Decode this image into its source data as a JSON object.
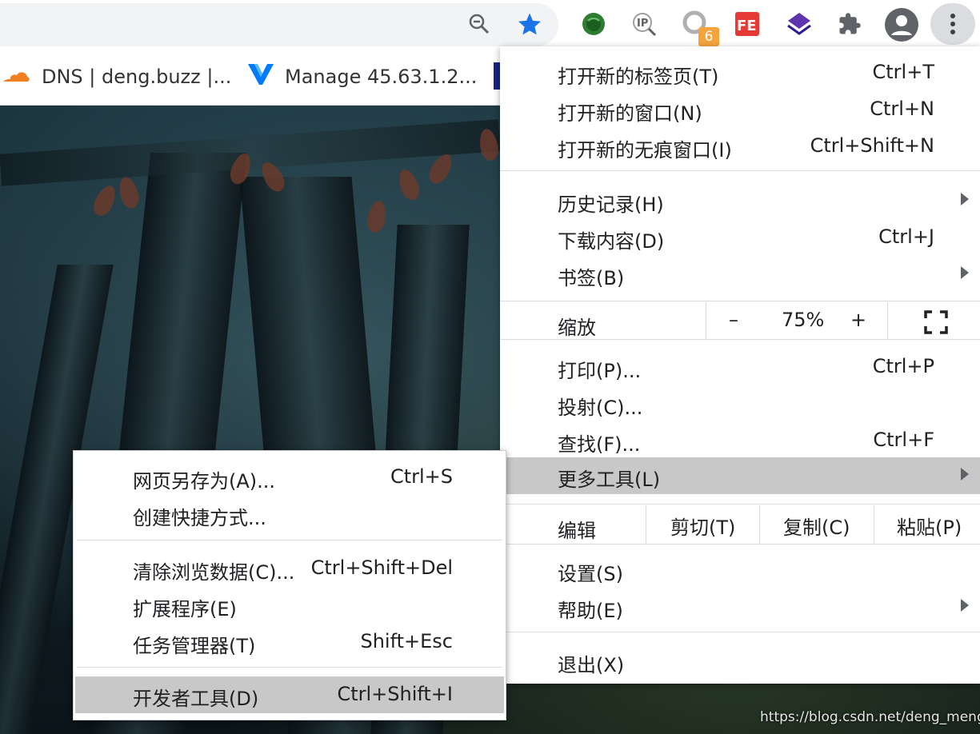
{
  "bookmarks": [
    {
      "label": "DNS | deng.buzz |...",
      "icon": "cloudflare-icon"
    },
    {
      "label": "Manage 45.63.1.2...",
      "icon": "vultr-icon"
    }
  ],
  "toolbar": {
    "extension_badge": "6",
    "extensions": [
      "zoom-icon",
      "bookmark-star-icon",
      "globe-extension-icon",
      "ip-lookup-icon",
      "badge-extension-icon",
      "fe-helper-icon",
      "layers-extension-icon",
      "extensions-puzzle-icon",
      "profile-avatar-icon",
      "kebab-menu-icon"
    ]
  },
  "main_menu": {
    "new_tab": {
      "label": "打开新的标签页(T)",
      "shortcut": "Ctrl+T"
    },
    "new_window": {
      "label": "打开新的窗口(N)",
      "shortcut": "Ctrl+N"
    },
    "new_incognito": {
      "label": "打开新的无痕窗口(I)",
      "shortcut": "Ctrl+Shift+N"
    },
    "history": {
      "label": "历史记录(H)"
    },
    "downloads": {
      "label": "下载内容(D)",
      "shortcut": "Ctrl+J"
    },
    "bookmarks": {
      "label": "书签(B)"
    },
    "zoom": {
      "label": "缩放",
      "minus": "–",
      "value": "75%",
      "plus": "+"
    },
    "print": {
      "label": "打印(P)...",
      "shortcut": "Ctrl+P"
    },
    "cast": {
      "label": "投射(C)..."
    },
    "find": {
      "label": "查找(F)...",
      "shortcut": "Ctrl+F"
    },
    "more_tools": {
      "label": "更多工具(L)"
    },
    "edit": {
      "label": "编辑",
      "cut": "剪切(T)",
      "copy": "复制(C)",
      "paste": "粘贴(P)"
    },
    "settings": {
      "label": "设置(S)"
    },
    "help": {
      "label": "帮助(E)"
    },
    "exit": {
      "label": "退出(X)"
    }
  },
  "sub_menu": {
    "save_page": {
      "label": "网页另存为(A)...",
      "shortcut": "Ctrl+S"
    },
    "create_shortcut": {
      "label": "创建快捷方式..."
    },
    "clear_data": {
      "label": "清除浏览数据(C)...",
      "shortcut": "Ctrl+Shift+Del"
    },
    "extensions": {
      "label": "扩展程序(E)"
    },
    "task_manager": {
      "label": "任务管理器(T)",
      "shortcut": "Shift+Esc"
    },
    "dev_tools": {
      "label": "开发者工具(D)",
      "shortcut": "Ctrl+Shift+I"
    }
  },
  "watermark": "https://blog.csdn.net/deng_menglihua",
  "colors": {
    "accent": "#1a73e8",
    "highlight": "#c8c8c8",
    "menu_bg": "#ffffff"
  }
}
